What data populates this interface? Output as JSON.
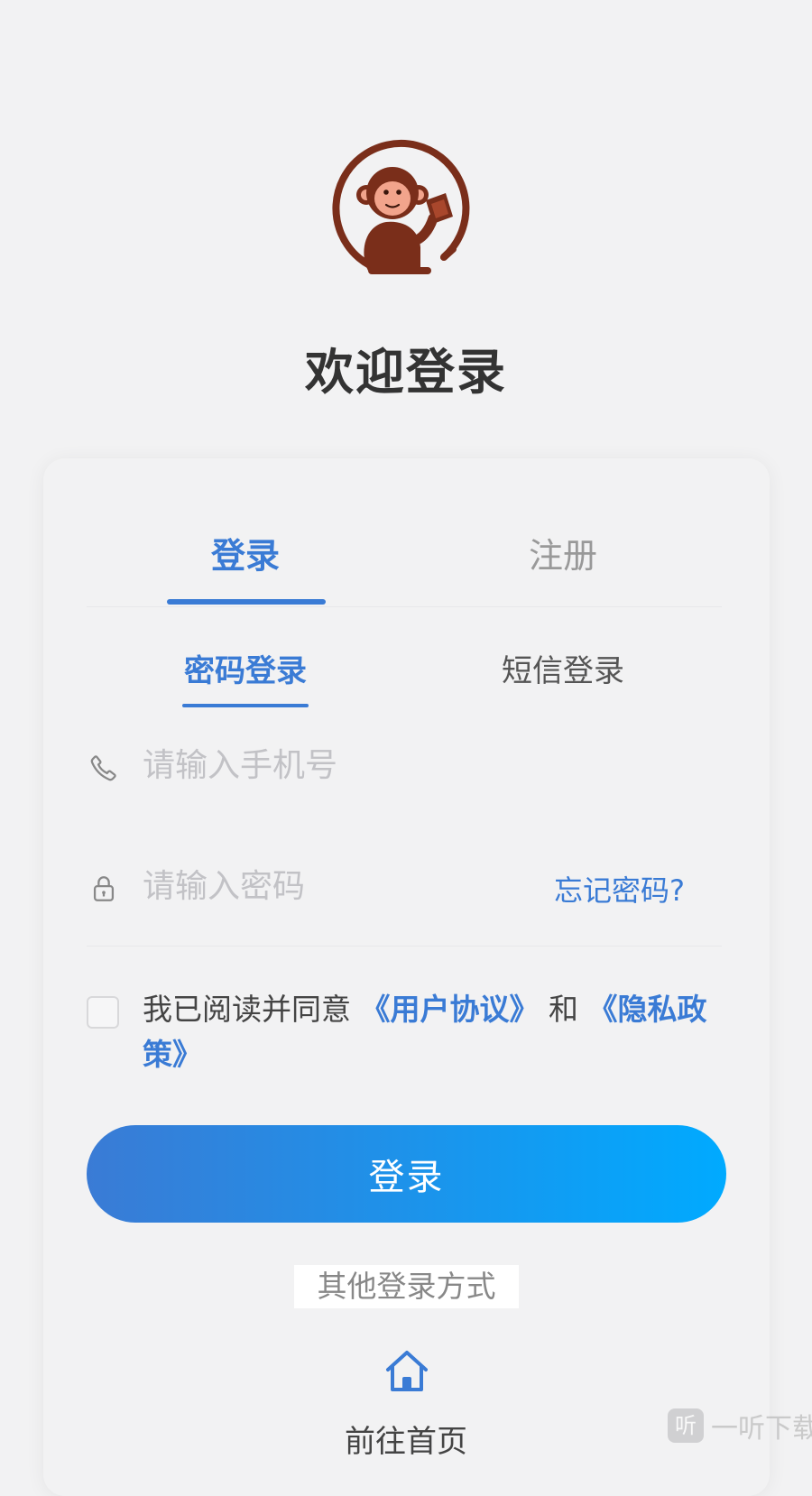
{
  "logo": {
    "icon": "monkey-reading-logo",
    "colors": {
      "brown": "#7a2e1a",
      "face": "#f2a48c"
    }
  },
  "welcome_title": "欢迎登录",
  "main_tabs": [
    {
      "label": "登录",
      "active": true
    },
    {
      "label": "注册",
      "active": false
    }
  ],
  "sub_tabs": [
    {
      "label": "密码登录",
      "active": true
    },
    {
      "label": "短信登录",
      "active": false
    }
  ],
  "phone": {
    "icon": "phone-icon",
    "placeholder": "请输入手机号",
    "value": ""
  },
  "password": {
    "icon": "lock-icon",
    "placeholder": "请输入密码",
    "value": "",
    "forgot_label": "忘记密码?"
  },
  "agreement": {
    "checked": false,
    "prefix": "我已阅读并同意 ",
    "user_agreement": "《用户协议》",
    "conjunction": " 和 ",
    "privacy_policy": "《隐私政策》"
  },
  "login_button": "登录",
  "other_ways_label": "其他登录方式",
  "home_link": {
    "icon": "home-icon",
    "label": "前往首页"
  },
  "watermark": {
    "badge": "听",
    "text": "一听下载"
  },
  "colors": {
    "accent": "#3a7bd5",
    "gradient_end": "#00aaff",
    "background": "#f2f2f3"
  }
}
